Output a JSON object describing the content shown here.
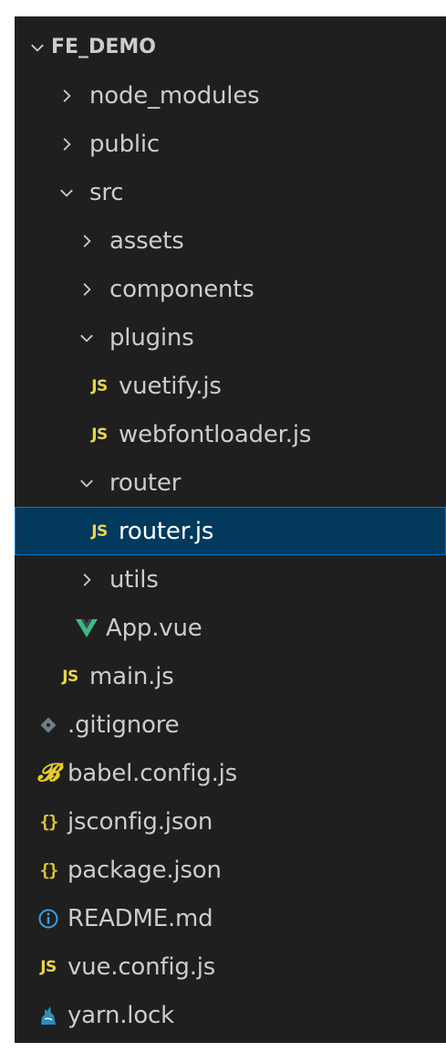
{
  "explorer": {
    "root": {
      "label": "FE_DEMO",
      "expanded": true
    },
    "items": [
      {
        "label": "node_modules",
        "kind": "folder",
        "depth": 1,
        "expanded": false
      },
      {
        "label": "public",
        "kind": "folder",
        "depth": 1,
        "expanded": false
      },
      {
        "label": "src",
        "kind": "folder",
        "depth": 1,
        "expanded": true
      },
      {
        "label": "assets",
        "kind": "folder",
        "depth": 2,
        "expanded": false
      },
      {
        "label": "components",
        "kind": "folder",
        "depth": 2,
        "expanded": false
      },
      {
        "label": "plugins",
        "kind": "folder",
        "depth": 2,
        "expanded": true
      },
      {
        "label": "vuetify.js",
        "kind": "js",
        "depth": 3,
        "icon_text": "JS"
      },
      {
        "label": "webfontloader.js",
        "kind": "js",
        "depth": 3,
        "icon_text": "JS"
      },
      {
        "label": "router",
        "kind": "folder",
        "depth": 2,
        "expanded": true
      },
      {
        "label": "router.js",
        "kind": "js",
        "depth": 3,
        "icon_text": "JS",
        "selected": true
      },
      {
        "label": "utils",
        "kind": "folder",
        "depth": 2,
        "expanded": false
      },
      {
        "label": "App.vue",
        "kind": "vue",
        "depth": 2
      },
      {
        "label": "main.js",
        "kind": "js",
        "depth": 1,
        "icon_text": "JS"
      },
      {
        "label": ".gitignore",
        "kind": "gitignore",
        "depth": 0
      },
      {
        "label": "babel.config.js",
        "kind": "babel",
        "depth": 0
      },
      {
        "label": "jsconfig.json",
        "kind": "json",
        "depth": 0,
        "icon_text": "{}"
      },
      {
        "label": "package.json",
        "kind": "json",
        "depth": 0,
        "icon_text": "{}"
      },
      {
        "label": "README.md",
        "kind": "info",
        "depth": 0
      },
      {
        "label": "vue.config.js",
        "kind": "js",
        "depth": 0,
        "icon_text": "JS"
      },
      {
        "label": "yarn.lock",
        "kind": "yarn",
        "depth": 0
      }
    ]
  },
  "colors": {
    "background": "#1f1f1f",
    "text": "#cccccc",
    "selected_background": "#04395e",
    "selected_border": "#0078d4",
    "js_icon": "#e8d44d",
    "vue_icon": "#41b883",
    "json_icon": "#d9c63a",
    "info_icon": "#3d9fde",
    "yarn_icon": "#2c8ebb",
    "gitignore_icon": "#6d8086"
  }
}
